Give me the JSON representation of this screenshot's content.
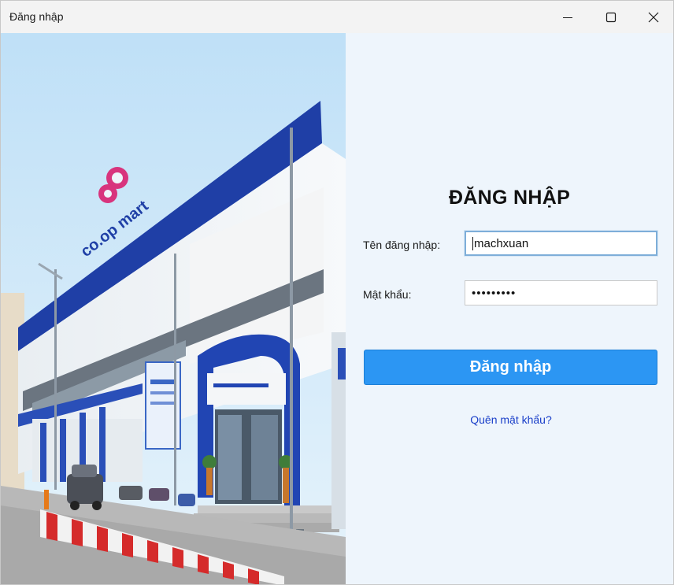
{
  "window": {
    "title": "Đăng nhập",
    "controls": [
      "minimize",
      "maximize",
      "close"
    ]
  },
  "photo": {
    "description_icon": "store-photo",
    "store_sign": "co.op mart"
  },
  "login": {
    "heading": "ĐĂNG NHẬP",
    "username_label": "Tên đăng nhập:",
    "username_value": "machxuan",
    "password_label": "Mật khẩu:",
    "password_value": "•••••••••",
    "submit_label": "Đăng nhập",
    "forgot_label": "Quên mật khẩu?"
  },
  "colors": {
    "panel_bg": "#eef5fc",
    "button_bg": "#2c96f3",
    "link": "#1a3fc9"
  }
}
